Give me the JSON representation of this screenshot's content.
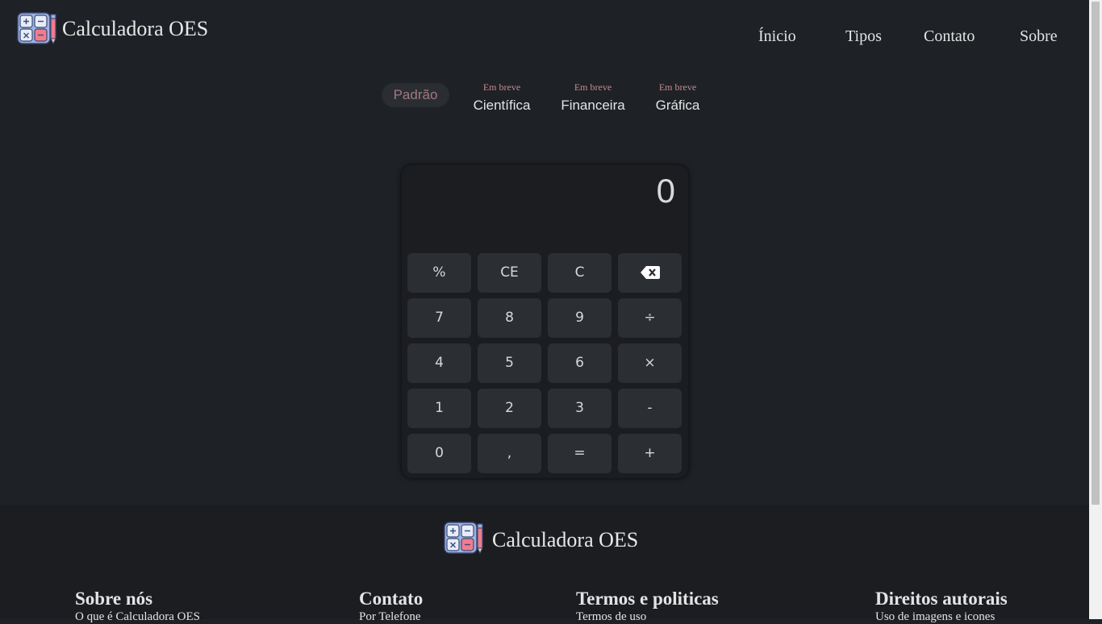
{
  "brand": {
    "name": "Calculadora OES"
  },
  "nav": {
    "items": [
      "Ínicio",
      "Tipos",
      "Contato",
      "Sobre"
    ]
  },
  "tabs": {
    "active": "Padrão",
    "soon_label": "Em breve",
    "others": [
      "Científica",
      "Financeira",
      "Gráfica"
    ]
  },
  "calculator": {
    "display": "0",
    "keys": [
      [
        "%",
        "CE",
        "C",
        "backspace-icon"
      ],
      [
        "7",
        "8",
        "9",
        "÷"
      ],
      [
        "4",
        "5",
        "6",
        "×"
      ],
      [
        "1",
        "2",
        "3",
        "-"
      ],
      [
        "0",
        ",",
        "=",
        "+"
      ]
    ]
  },
  "footer": {
    "brand_name": "Calculadora OES",
    "columns": [
      {
        "title": "Sobre nós",
        "link": "O que é Calculadora OES"
      },
      {
        "title": "Contato",
        "link": "Por Telefone"
      },
      {
        "title": "Termos e politicas",
        "link": "Termos de uso"
      },
      {
        "title": "Direitos autorais",
        "link": "Uso de imagens e icones"
      }
    ]
  },
  "colors": {
    "background": "#1e2125",
    "accent_pink": "#c78a93",
    "key_bg": "#2b2e33"
  }
}
